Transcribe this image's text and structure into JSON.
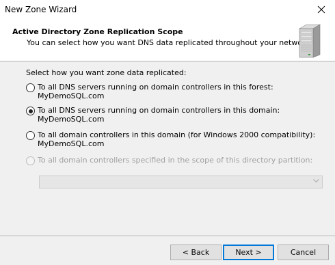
{
  "window": {
    "title": "New Zone Wizard"
  },
  "header": {
    "title": "Active Directory Zone Replication Scope",
    "subtitle": "You can select how you want DNS data replicated throughout your network."
  },
  "main": {
    "prompt": "Select how you want zone data replicated:",
    "options": [
      {
        "label": "To all DNS servers running on domain controllers in this forest: MyDemoSQL.com",
        "checked": false,
        "enabled": true
      },
      {
        "label": "To all DNS servers running on domain controllers in this domain: MyDemoSQL.com",
        "checked": true,
        "enabled": true
      },
      {
        "label_line1": "To all domain controllers in this domain (for Windows 2000 compatibility):",
        "label_line2": "MyDemoSQL.com",
        "checked": false,
        "enabled": true
      },
      {
        "label": "To all domain controllers specified in the scope of this directory partition:",
        "checked": false,
        "enabled": false
      }
    ],
    "partition_select": {
      "value": "",
      "enabled": false
    }
  },
  "footer": {
    "back_label": "< Back",
    "next_label": "Next >",
    "cancel_label": "Cancel"
  },
  "colors": {
    "accent": "#0078d7",
    "disabled_text": "#a0a0a0"
  }
}
